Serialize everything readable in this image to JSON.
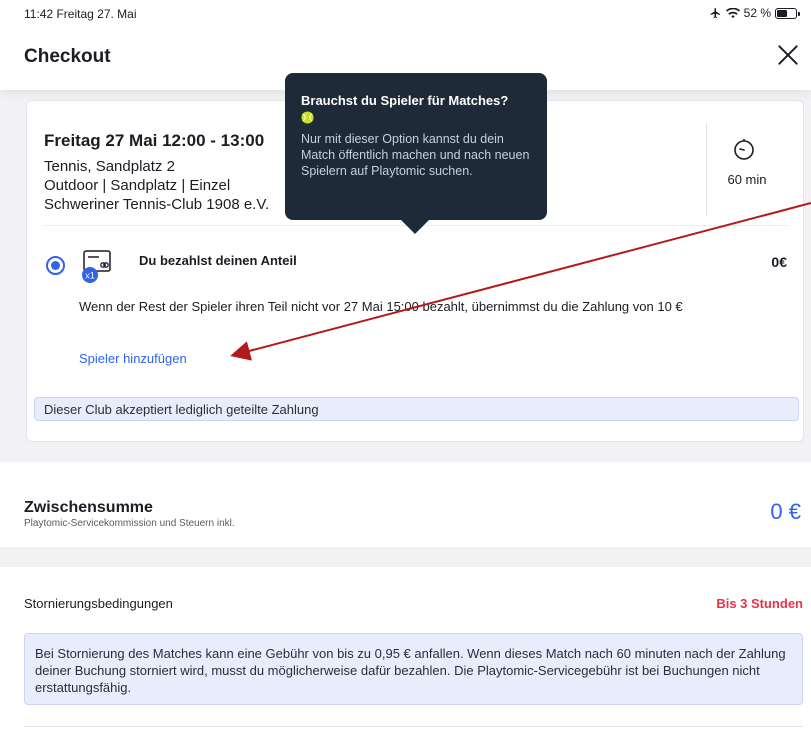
{
  "statusbar": {
    "time": "11:42  Freitag 27. Mai",
    "battery": "52 %"
  },
  "header": {
    "title": "Checkout"
  },
  "booking": {
    "date": "Freitag 27 Mai 12:00 - 13:00",
    "court": "Tennis, Sandplatz 2",
    "details": "Outdoor | Sandplatz | Einzel",
    "club": "Schweriner Tennis-Club 1908 e.V.",
    "duration": "60 min"
  },
  "payment": {
    "badge": "x1",
    "label": "Du bezahlst deinen Anteil",
    "amount": "0€",
    "note": "Wenn der Rest der Spieler ihren Teil nicht vor 27 Mai 15:00 bezahlt, übernimmst du die Zahlung von 10 €",
    "add_players": "Spieler hinzufügen",
    "info": "Dieser Club akzeptiert lediglich geteilte Zahlung"
  },
  "tooltip": {
    "title": "Brauchst du Spieler für Matches?",
    "body": "Nur mit dieser Option kannst du dein Match öffentlich machen und nach neuen Spielern auf Playtomic suchen."
  },
  "subtotal": {
    "title": "Zwischensumme",
    "subtitle": "Playtomic-Servicekommission und Steuern inkl.",
    "amount": "0 €"
  },
  "cancellation": {
    "title": "Stornierungsbedingungen",
    "time": "Bis 3 Stunden",
    "text": "Bei Stornierung des Matches kann eine Gebühr von bis zu 0,95 € anfallen. Wenn dieses Match nach 60 minuten nach der Zahlung deiner Buchung storniert wird, musst du möglicherweise dafür bezahlen. Die Playtomic-Servicegebühr ist bei Buchungen nicht erstattungsfähig."
  },
  "colors": {
    "accent": "#2f63e8",
    "danger": "#e5334a",
    "tooltip_bg": "#1e2a38",
    "annotation_arrow": "#b3191b"
  }
}
